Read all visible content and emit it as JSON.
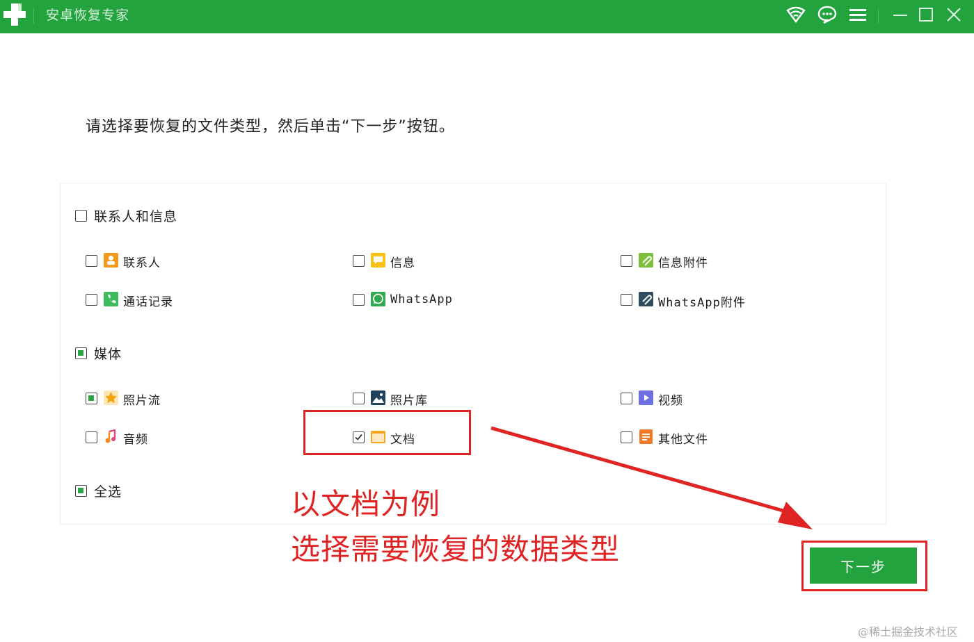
{
  "app": {
    "title": "安卓恢复专家"
  },
  "instruction": "请选择要恢复的文件类型，然后单击“下一步”按钮。",
  "groups": [
    {
      "label": "联系人和信息",
      "state": "unchecked",
      "items": [
        {
          "label": "联系人",
          "icon": "contact-icon",
          "checked": false
        },
        {
          "label": "信息",
          "icon": "message-icon",
          "checked": false
        },
        {
          "label": "信息附件",
          "icon": "attachment-icon",
          "checked": false
        },
        {
          "label": "通话记录",
          "icon": "phone-icon",
          "checked": false
        },
        {
          "label": "WhatsApp",
          "icon": "whatsapp-icon",
          "checked": false
        },
        {
          "label": "WhatsApp附件",
          "icon": "whatsapp-attachment-icon",
          "checked": false
        }
      ]
    },
    {
      "label": "媒体",
      "state": "partial",
      "items": [
        {
          "label": "照片流",
          "icon": "star-photo-icon",
          "checked": "partial"
        },
        {
          "label": "照片库",
          "icon": "image-icon",
          "checked": false
        },
        {
          "label": "视频",
          "icon": "video-icon",
          "checked": false
        },
        {
          "label": "音频",
          "icon": "audio-icon",
          "checked": false
        },
        {
          "label": "文档",
          "icon": "folder-icon",
          "checked": true
        },
        {
          "label": "其他文件",
          "icon": "file-icon",
          "checked": false
        }
      ]
    }
  ],
  "select_all": {
    "label": "全选",
    "state": "partial"
  },
  "annotation": {
    "line1": "以文档为例",
    "line2": "选择需要恢复的数据类型"
  },
  "next_button": "下一步",
  "watermark": "@稀土掘金技术社区",
  "colors": {
    "brand": "#22a33e",
    "highlight": "#e02424"
  }
}
